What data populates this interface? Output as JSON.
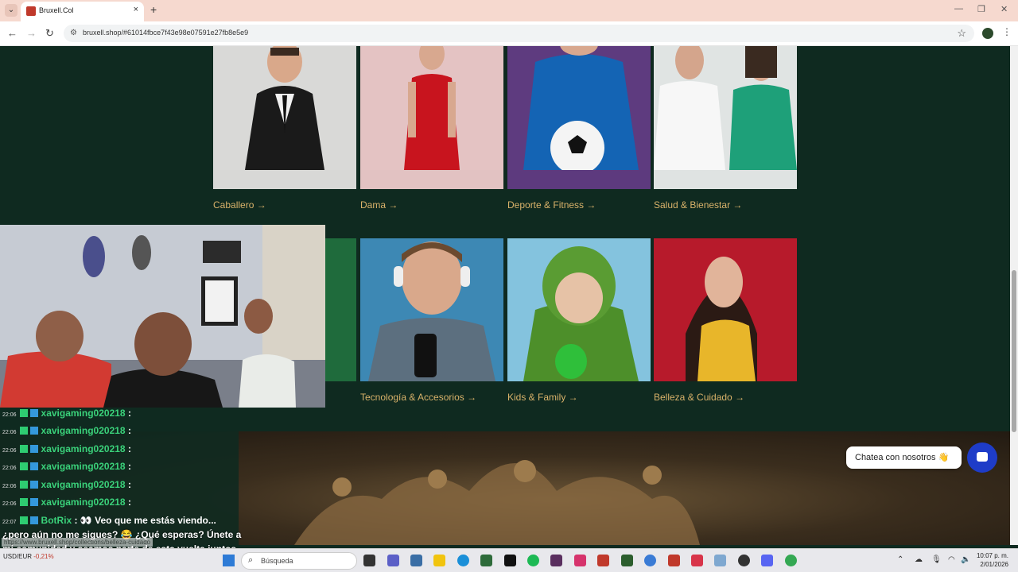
{
  "browser": {
    "tab_title": "Bruxell.Col",
    "url": "bruxell.shop/#61014fbce7f43e98e07591e27fb8e5e9",
    "new_tab": "+",
    "tab_close": "×"
  },
  "categories_row1": [
    {
      "label": "Caballero →",
      "bg": "#d8d8d6"
    },
    {
      "label": "Dama →",
      "bg": "#e2c2c2"
    },
    {
      "label": "Deporte & Fitness →",
      "bg": "#5d3a7e"
    },
    {
      "label": "Salud & Bienestar →",
      "bg": "#dfe3e2"
    }
  ],
  "categories_row2": [
    {
      "label": "",
      "bg": "#1f6b3c"
    },
    {
      "label": "Tecnología & Accesorios →",
      "bg": "#3c87b3"
    },
    {
      "label": "Kids & Family →",
      "bg": "#7fc0dc"
    },
    {
      "label": "Belleza & Cuidado →",
      "bg": "#b81b2c"
    }
  ],
  "chat_widget": {
    "text": "Chatea con nosotros 👋"
  },
  "overlay_chat": {
    "rows": [
      {
        "time": "22:06",
        "user": "xavigaming020218",
        "colon": ":"
      },
      {
        "time": "22:06",
        "user": "xavigaming020218",
        "colon": ":"
      },
      {
        "time": "22:06",
        "user": "xavigaming020218",
        "colon": ":"
      },
      {
        "time": "22:06",
        "user": "xavigaming020218",
        "colon": ":"
      },
      {
        "time": "22:06",
        "user": "xavigaming020218",
        "colon": ":"
      },
      {
        "time": "22:06",
        "user": "xavigaming020218",
        "colon": ":"
      }
    ],
    "bot_time": "22:07",
    "bot_user": "BotRix",
    "bot_msg": ": 👀 Veo que me estás viendo...",
    "line2": "¿pero aún no me sigues? 😂 ¿Qué esperas? Únete a",
    "line3": "mi comunidad y seamos parte de esta vuelta juntos.",
    "status_url": "https://www.bruxell.shop/collections/belleza-cuidado"
  },
  "taskbar": {
    "search_placeholder": "Búsqueda",
    "stock_name": "USD/EUR",
    "stock_change": "-0,21%",
    "time": "10:07 p. m.",
    "date": "2/01/2026"
  }
}
